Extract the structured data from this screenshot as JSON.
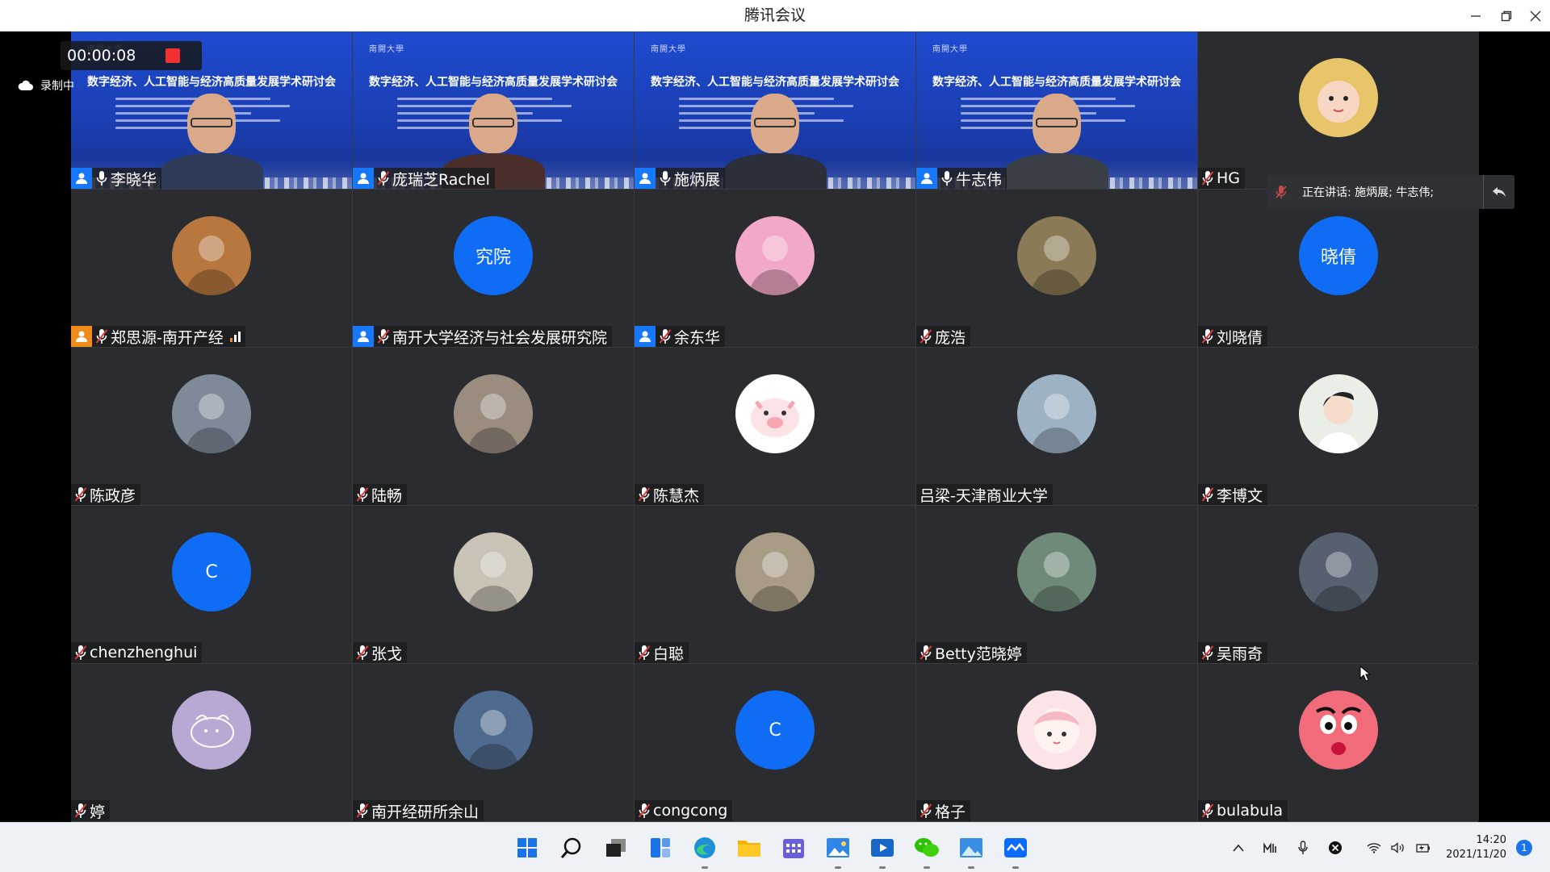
{
  "window": {
    "title": "腾讯会议"
  },
  "recording": {
    "elapsed": "00:00:08",
    "status": "录制中"
  },
  "speaking_banner": {
    "text": "正在讲话: 施炳展; 牛志伟;"
  },
  "slide": {
    "logo_text": "南開大學",
    "title": "数字经济、人工智能与经济高质量发展学术研讨会"
  },
  "participants": [
    {
      "name": "李晓华",
      "host": "blue",
      "mic": "on",
      "kind": "video",
      "shirt": "#2d3b58",
      "glasses": true
    },
    {
      "name": "庞瑞芝Rachel",
      "host": "blue",
      "mic": "off",
      "kind": "video",
      "shirt": "#4a2e2a",
      "glasses": true
    },
    {
      "name": "施炳展",
      "host": "blue",
      "mic": "on",
      "kind": "video",
      "shirt": "#2a2f3a",
      "glasses": true,
      "active": true
    },
    {
      "name": "牛志伟",
      "host": "blue",
      "mic": "on",
      "kind": "video",
      "shirt": "#3b3f48",
      "glasses": true
    },
    {
      "name": "HG",
      "host": "",
      "mic": "off",
      "kind": "avatar",
      "avatar_icon": "baby-photo",
      "avatar_color": "#e8c46a"
    },
    {
      "name": "郑思源-南开产经",
      "host": "orange",
      "mic": "off",
      "kind": "avatar",
      "avatar_icon": "fruit-basket-photo",
      "avatar_color": "#b7773f",
      "signal": true
    },
    {
      "name": "南开大学经济与社会发展研究院",
      "host": "blue",
      "mic": "off",
      "kind": "text",
      "avatar_text": "究院"
    },
    {
      "name": "余东华",
      "host": "blue",
      "mic": "off",
      "kind": "avatar",
      "avatar_icon": "lotus-photo",
      "avatar_color": "#f2a8c8"
    },
    {
      "name": "庞浩",
      "host": "",
      "mic": "off",
      "kind": "avatar",
      "avatar_icon": "lynx-photo",
      "avatar_color": "#8a7a55"
    },
    {
      "name": "刘晓倩",
      "host": "",
      "mic": "off",
      "kind": "text",
      "avatar_text": "晓倩"
    },
    {
      "name": "陈政彦",
      "host": "",
      "mic": "off",
      "kind": "avatar",
      "avatar_icon": "ultraman-photo",
      "avatar_color": "#7f8a99"
    },
    {
      "name": "陆畅",
      "host": "",
      "mic": "off",
      "kind": "avatar",
      "avatar_icon": "person-hat-photo",
      "avatar_color": "#9a8d80"
    },
    {
      "name": "陈慧杰",
      "host": "",
      "mic": "off",
      "kind": "avatar",
      "avatar_icon": "cartoon-pig",
      "avatar_color": "#fde3e6"
    },
    {
      "name": "吕梁-天津商业大学",
      "host": "",
      "mic": "none",
      "kind": "avatar",
      "avatar_icon": "mountain-photo",
      "avatar_color": "#9db2c4"
    },
    {
      "name": "李博文",
      "host": "",
      "mic": "off",
      "kind": "avatar",
      "avatar_icon": "anime-boy",
      "avatar_color": "#e9efe6"
    },
    {
      "name": "chenzhenghui",
      "host": "",
      "mic": "off",
      "kind": "text",
      "avatar_text": "C"
    },
    {
      "name": "张戈",
      "host": "",
      "mic": "off",
      "kind": "avatar",
      "avatar_icon": "stone-tablet-photo",
      "avatar_color": "#c9c3b5"
    },
    {
      "name": "白聪",
      "host": "",
      "mic": "off",
      "kind": "avatar",
      "avatar_icon": "yawning-cat-photo",
      "avatar_color": "#a89c86"
    },
    {
      "name": "Betty范晓婷",
      "host": "",
      "mic": "off",
      "kind": "avatar",
      "avatar_icon": "camo-soldier-photo",
      "avatar_color": "#6f8a78"
    },
    {
      "name": "吴雨奇",
      "host": "",
      "mic": "off",
      "kind": "avatar",
      "avatar_icon": "street-photo",
      "avatar_color": "#56606e"
    },
    {
      "name": "婷",
      "host": "",
      "mic": "off",
      "kind": "avatar",
      "avatar_icon": "doodle-bear",
      "avatar_color": "#b8a8d4"
    },
    {
      "name": "南开经研所余山",
      "host": "",
      "mic": "off",
      "kind": "avatar",
      "avatar_icon": "sunset-photo",
      "avatar_color": "#4f6a8f"
    },
    {
      "name": "congcong",
      "host": "",
      "mic": "off",
      "kind": "text",
      "avatar_text": "C"
    },
    {
      "name": "格子",
      "host": "",
      "mic": "off",
      "kind": "avatar",
      "avatar_icon": "cartoon-girl",
      "avatar_color": "#fbe3e8"
    },
    {
      "name": "bulabula",
      "host": "",
      "mic": "off",
      "kind": "avatar",
      "avatar_icon": "cartoon-face",
      "avatar_color": "#f26b7a"
    }
  ],
  "taskbar": {
    "apps": [
      "start-icon",
      "search-icon",
      "task-view-icon",
      "widgets-icon",
      "edge-icon",
      "file-explorer-icon",
      "calendar-app-icon",
      "photos-icon",
      "media-player-icon",
      "wechat-icon",
      "image-viewer-icon",
      "tencent-meeting-icon"
    ],
    "clock_time": "14:20",
    "clock_date": "2021/11/20",
    "notifications": "1"
  }
}
